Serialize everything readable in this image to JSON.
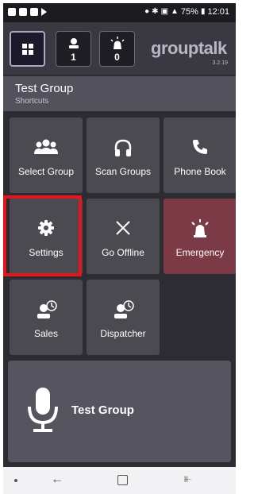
{
  "status_bar": {
    "battery": "75%",
    "time": "12:01"
  },
  "header": {
    "users_count": "1",
    "alerts_count": "0",
    "logo": "grouptalk",
    "version": "3.2.19"
  },
  "group": {
    "title": "Test Group",
    "subtitle": "Shortcuts"
  },
  "tiles": [
    {
      "label": "Select Group",
      "icon": "people-group-icon"
    },
    {
      "label": "Scan Groups",
      "icon": "headphones-icon"
    },
    {
      "label": "Phone Book",
      "icon": "phone-icon"
    },
    {
      "label": "Settings",
      "icon": "gear-icon"
    },
    {
      "label": "Go Offline",
      "icon": "close-icon"
    },
    {
      "label": "Emergency",
      "icon": "siren-icon"
    },
    {
      "label": "Sales",
      "icon": "user-clock-icon"
    },
    {
      "label": "Dispatcher",
      "icon": "user-clock-icon"
    }
  ],
  "ptt": {
    "label": "Test Group",
    "icon": "microphone-icon"
  },
  "colors": {
    "background": "#2d2c33",
    "tile": "#4b4a50",
    "emergency": "#7b3a46",
    "highlight": "#e8141a"
  }
}
